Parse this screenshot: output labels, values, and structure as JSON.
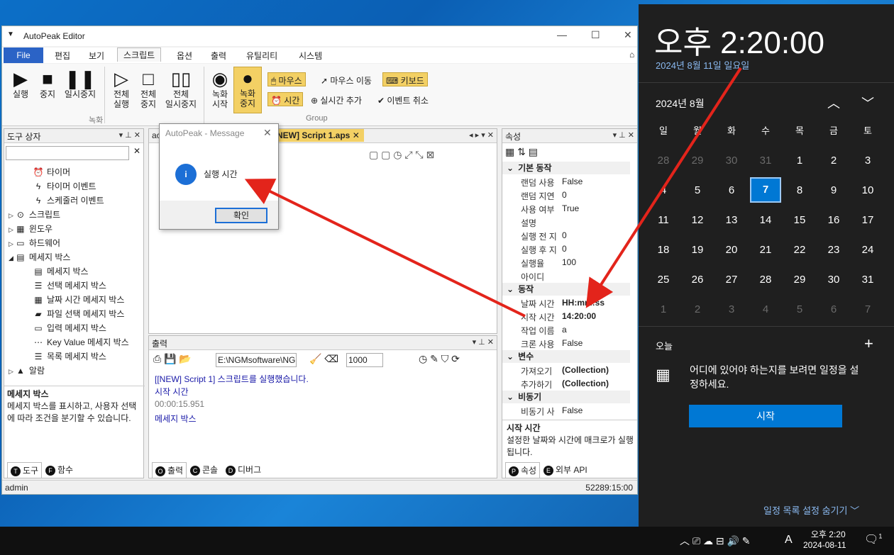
{
  "app": {
    "title": "AutoPeak Editor",
    "menus": [
      "File",
      "편집",
      "보기",
      "스크립트",
      "옵션",
      "출력",
      "유틸리티",
      "시스템"
    ]
  },
  "ribbon": {
    "buttons": [
      "실행",
      "중지",
      "일시중지",
      "전체\n실행",
      "전체\n중지",
      "전체\n일시중지",
      "녹화\n시작",
      "녹화\n중지"
    ],
    "chips": [
      "마우스",
      "마우스 이동",
      "키보드",
      "시간",
      "실시간 추가",
      "이벤트 취소"
    ],
    "groups": [
      "녹화",
      "Group"
    ]
  },
  "toolbox": {
    "title": "도구 상자",
    "items": [
      "타이머",
      "타이머 이벤트",
      "스케줄러 이벤트",
      "스크립트",
      "윈도우",
      "하드웨어",
      "메세지 박스",
      "메세지 박스",
      "선택 메세지 박스",
      "날짜 시간 메세지 박스",
      "파일 선택 메세지 박스",
      "입력 메세지 박스",
      "Key Value 메세지 박스",
      "목록 메세지 박스",
      "알람"
    ],
    "desc_title": "메세지 박스",
    "desc": "메세지 박스를 표시하고, 사용자 선택에 따라 조건을 분기할 수 있습니다.",
    "tabs": [
      "도구",
      "함수"
    ]
  },
  "editor": {
    "tab": "[NEW] Script 1.aps",
    "tab_prefix": "ac",
    "line": "["
  },
  "message": {
    "title": "AutoPeak - Message",
    "text": "실행 시간",
    "ok": "확인"
  },
  "output": {
    "title": "출력",
    "path": "E:\\NGMsoftware\\NG",
    "count": "1000",
    "lines": [
      "[[NEW] Script 1] 스크립트를 실행했습니다.",
      "시작 시간",
      "00:00:15.951",
      "메세지 박스"
    ],
    "tabs": [
      "출력",
      "콘솔",
      "디버그"
    ]
  },
  "props": {
    "title": "속성",
    "sections": [
      "기본 동작",
      "동작",
      "변수",
      "비동기"
    ],
    "basic": [
      [
        "랜덤 사용",
        "False"
      ],
      [
        "랜덤 지연",
        "0"
      ],
      [
        "사용 여부",
        "True"
      ],
      [
        "설명",
        ""
      ],
      [
        "실행 전 지",
        "0"
      ],
      [
        "실행 후 지",
        "0"
      ],
      [
        "실행율",
        "100"
      ],
      [
        "아이디",
        ""
      ]
    ],
    "action": [
      [
        "날짜 시간",
        "HH:mm:ss"
      ],
      [
        "시작 시간",
        "14:20:00"
      ],
      [
        "작업 이름",
        "a"
      ],
      [
        "크론 사용",
        "False"
      ]
    ],
    "vars": [
      [
        "가져오기",
        "(Collection)"
      ],
      [
        "추가하기",
        "(Collection)"
      ]
    ],
    "async": [
      [
        "비동기 사",
        "False"
      ]
    ],
    "desc_title": "시작 시간",
    "desc": "설정한 날짜와 시간에 매크로가 실행됩니다.",
    "tabs": [
      "속성",
      "외부 API"
    ]
  },
  "status": {
    "user": "admin",
    "time": "52289:15:00"
  },
  "clock": {
    "time": "오후 2:20:00",
    "date": "2024년 8월 11일 일요일",
    "month": "2024년 8월",
    "weekdays": [
      "일",
      "월",
      "화",
      "수",
      "목",
      "금",
      "토"
    ],
    "days": [
      "28",
      "29",
      "30",
      "31",
      "1",
      "2",
      "3",
      "4",
      "5",
      "6",
      "7",
      "8",
      "9",
      "10",
      "11",
      "12",
      "13",
      "14",
      "15",
      "16",
      "17",
      "18",
      "19",
      "20",
      "21",
      "22",
      "23",
      "24",
      "25",
      "26",
      "27",
      "28",
      "29",
      "30",
      "31",
      "1",
      "2",
      "3",
      "4",
      "5",
      "6",
      "7"
    ],
    "today": "11",
    "agenda_title": "오늘",
    "agenda_text": "어디에 있어야 하는지를 보려면 일정을 설정하세요.",
    "start_btn": "시작",
    "hide": "일정 목록 설정 숨기기"
  },
  "taskbar": {
    "time": "오후 2:20",
    "date": "2024-08-11",
    "lang": "A",
    "notif": "1"
  },
  "colors": {
    "accent": "#0078d4",
    "chip": "#f3d064",
    "arrow": "#e3241b",
    "output_blue": "#1a1aa8"
  }
}
